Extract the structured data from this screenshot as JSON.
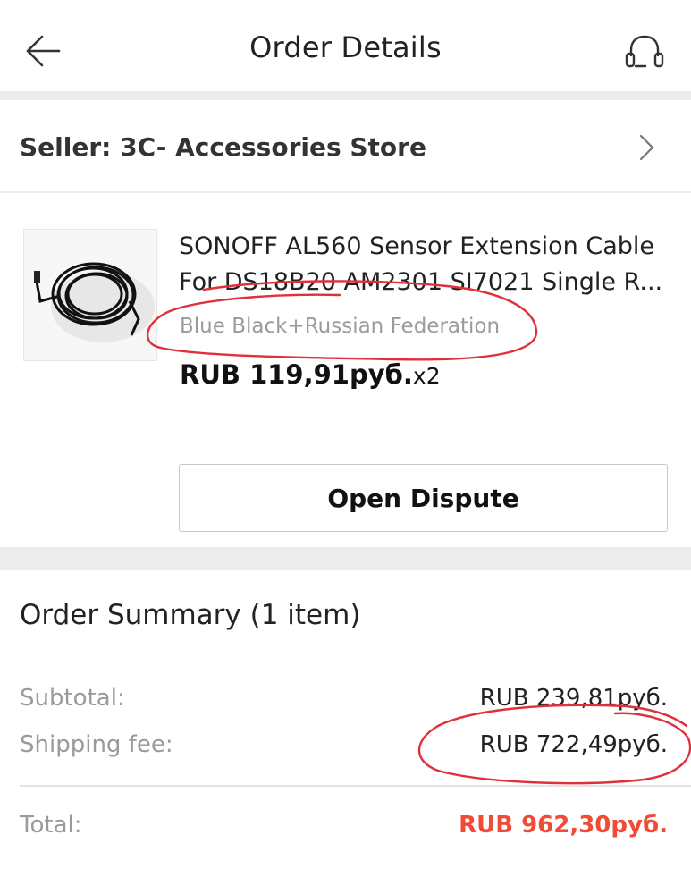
{
  "header": {
    "title": "Order Details",
    "back_icon": "arrow-left-icon",
    "support_icon": "headset-icon"
  },
  "seller": {
    "label": "Seller: 3C- Accessories Store",
    "chevron_icon": "chevron-right-icon"
  },
  "product": {
    "title_line1": "SONOFF AL560 Sensor Extension Cable",
    "title_line2": "For DS18B20 AM2301 SI7021 Single R...",
    "variant": "Blue Black+Russian Federation",
    "price": "RUB 119,91руб.",
    "quantity": "x2",
    "dispute_button": "Open Dispute"
  },
  "summary": {
    "title": "Order Summary (1 item)",
    "subtotal_label": "Subtotal:",
    "subtotal_value": "RUB 239,81руб.",
    "shipping_label": "Shipping fee:",
    "shipping_value": "RUB 722,49руб.",
    "total_label": "Total:",
    "total_value": "RUB 962,30руб."
  },
  "colors": {
    "accent_total": "#f04b36",
    "annotation_ink": "#e0303c",
    "separator": "#ececec"
  }
}
